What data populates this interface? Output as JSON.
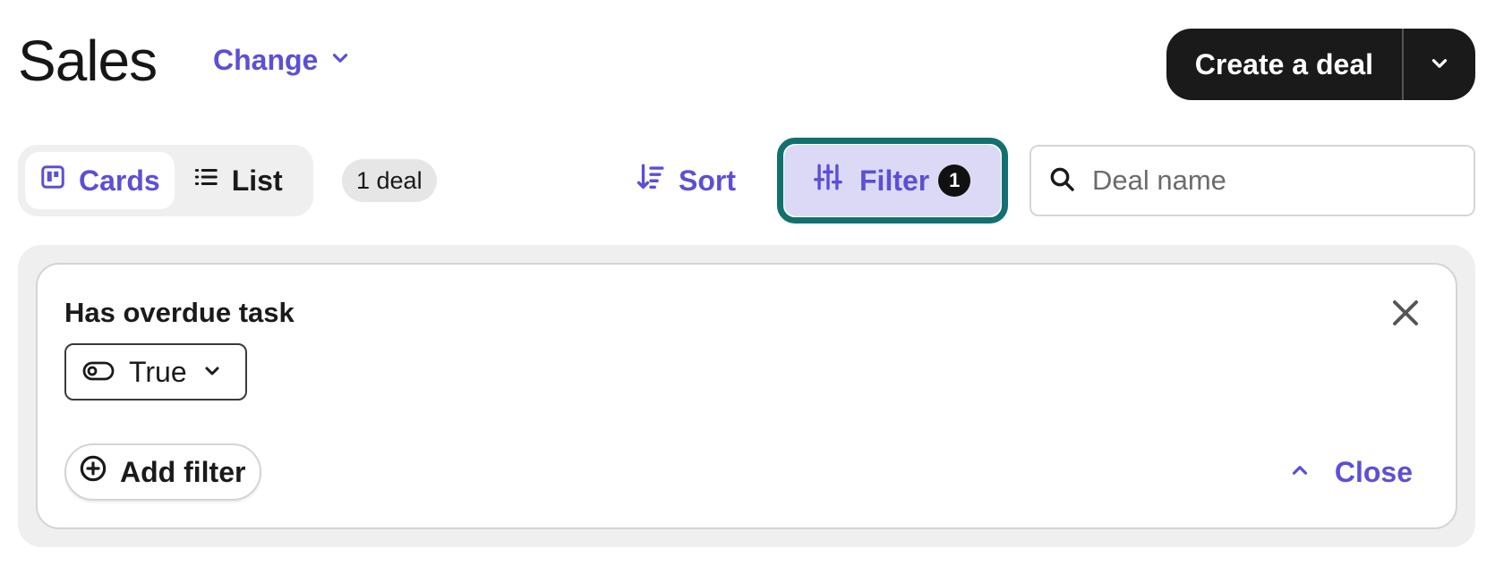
{
  "header": {
    "title": "Sales",
    "change_label": "Change",
    "create_label": "Create a deal"
  },
  "toolbar": {
    "views": [
      {
        "label": "Cards",
        "active": true,
        "icon": "kanban-board-icon"
      },
      {
        "label": "List",
        "active": false,
        "icon": "list-icon"
      }
    ],
    "deal_count": "1 deal",
    "sort_label": "Sort",
    "filter_label": "Filter",
    "filter_count": "1",
    "search_placeholder": "Deal name"
  },
  "filter_panel": {
    "rules": [
      {
        "label": "Has overdue task",
        "value": "True",
        "value_icon": "toggle-icon"
      }
    ],
    "add_filter_label": "Add filter",
    "close_label": "Close"
  },
  "colors": {
    "accent": "#5b4fd6",
    "focus_ring": "#137070",
    "filter_active_bg": "#dcd9f7",
    "primary_button": "#1a1a1a"
  }
}
